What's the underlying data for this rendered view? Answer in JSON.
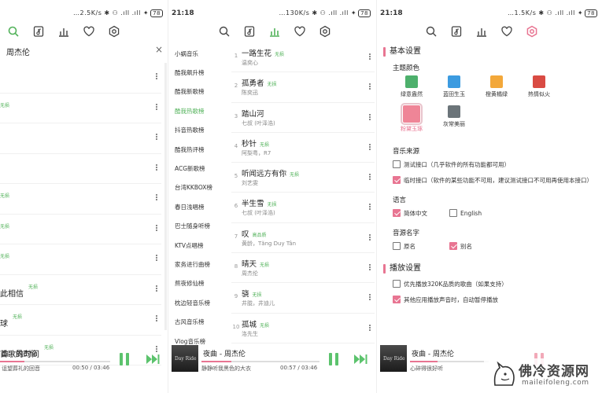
{
  "panel1": {
    "status": {
      "right": "…2.5K/s ✱ ⚇ .ıll .ıll ✦"
    },
    "battery": "78",
    "search": {
      "query": "周杰伦",
      "clear": "×"
    },
    "songs": [
      {
        "title": "",
        "tag": ""
      },
      {
        "title": "",
        "tag": "无损"
      },
      {
        "title": "",
        "tag": ""
      },
      {
        "title": "",
        "tag": ""
      },
      {
        "title": "",
        "tag": "无损"
      },
      {
        "title": "",
        "tag": "无损"
      },
      {
        "title": "",
        "tag": "无损"
      },
      {
        "title": "此相信",
        "tag": "无损"
      },
      {
        "title": "球",
        "tag": "无损"
      },
      {
        "title": "首歌的时间",
        "tag": "无损"
      }
    ],
    "player": {
      "title": "曲 - 周杰伦",
      "lyric": "诅望葬礼的回音",
      "time": "00:50 / 03:46",
      "progress": 0.22
    }
  },
  "panel2": {
    "status": {
      "time": "21:18",
      "right": "…130K/s ✱ ⚇ .ıll .ıll ✦"
    },
    "battery": "78",
    "rank_lists": [
      "小蜗音乐",
      "酷我飙升榜",
      "酷我新歌榜",
      "酷我热歌榜",
      "抖音热歌榜",
      "酷我热评榜",
      "ACG新歌榜",
      "台湾KKBOX榜",
      "春日浅唱榜",
      "巴士随身听榜",
      "KTV点唱榜",
      "家务进行曲榜",
      "熬夜修仙榜",
      "枕边轻音乐榜",
      "古风音乐榜",
      "Vlog音乐榜"
    ],
    "active_index": 3,
    "chart": [
      {
        "n": "1",
        "title": "一路生花",
        "tag": "无损",
        "artist": "温奕心"
      },
      {
        "n": "2",
        "title": "孤勇者",
        "tag": "无损",
        "artist": "陈奕迅"
      },
      {
        "n": "3",
        "title": "踏山河",
        "tag": "",
        "artist": "七叔 (叶泽浩)"
      },
      {
        "n": "4",
        "title": "秒针",
        "tag": "无损",
        "artist": "阿梨粤，R7"
      },
      {
        "n": "5",
        "title": "听闻远方有你",
        "tag": "无损",
        "artist": "刘艺雯"
      },
      {
        "n": "6",
        "title": "半生雪",
        "tag": "无损",
        "artist": "七叔 (叶泽浩)"
      },
      {
        "n": "7",
        "title": "叹",
        "tag": "高品质",
        "artist": "黄龄，Tăng Duy Tân"
      },
      {
        "n": "8",
        "title": "晴天",
        "tag": "无损",
        "artist": "周杰伦"
      },
      {
        "n": "9",
        "title": "骁",
        "tag": "无损",
        "artist": "井胧，井迪儿"
      },
      {
        "n": "10",
        "title": "孤城",
        "tag": "无损",
        "artist": "洛先生"
      }
    ],
    "player": {
      "title": "夜曲 - 周杰伦",
      "lyric": "静静听我黑色的大衣",
      "time": "00:57 / 03:46",
      "progress": 0.25,
      "cover_text": "Day Ride"
    }
  },
  "panel3": {
    "status": {
      "time": "21:18",
      "right": "…1.5K/s ✱ ⚇ .ıll .ıll ✦"
    },
    "battery": "78",
    "basic_title": "基本设置",
    "theme_label": "主题颜色",
    "themes": [
      {
        "label": "绿意盎然",
        "color": "#4db06c",
        "selected": false
      },
      {
        "label": "蓝田生玉",
        "color": "#3c9be0",
        "selected": false
      },
      {
        "label": "橙黄橘绿",
        "color": "#f3a83a",
        "selected": false
      },
      {
        "label": "热情似火",
        "color": "#d94b43",
        "selected": false
      },
      {
        "label": "粉黛玉琢",
        "color": "#ef8597",
        "selected": true
      },
      {
        "label": "灰常美丽",
        "color": "#6b7479",
        "selected": false
      }
    ],
    "source_label": "音乐来源",
    "source_opts": [
      {
        "text": "测试接口（几乎软件的所有功能都可用）",
        "checked": false
      },
      {
        "text": "临时接口（软件的某些功能不可用，建议测试接口不可用再使用本接口）",
        "checked": true
      }
    ],
    "lang_label": "语言",
    "lang_opts": [
      {
        "text": "简体中文",
        "checked": true
      },
      {
        "text": "English",
        "checked": false
      }
    ],
    "name_label": "音源名字",
    "name_opts": [
      {
        "text": "原名",
        "checked": false
      },
      {
        "text": "别名",
        "checked": true
      }
    ],
    "play_title": "播放设置",
    "play_opts": [
      {
        "text": "优先播放320K品质的歌曲（如果支持）",
        "checked": false
      },
      {
        "text": "其他应用播放声音时，自动暂停播放",
        "checked": true
      }
    ],
    "player": {
      "title": "夜曲 - 周杰伦",
      "lyric": "心碎得很好听",
      "progress": 0.35
    }
  },
  "watermark": {
    "title": "佛冷资源网",
    "sub": "maileifoleng.com"
  },
  "colors": {
    "accent_green": "#52b25a",
    "accent_pink": "#e87592"
  }
}
